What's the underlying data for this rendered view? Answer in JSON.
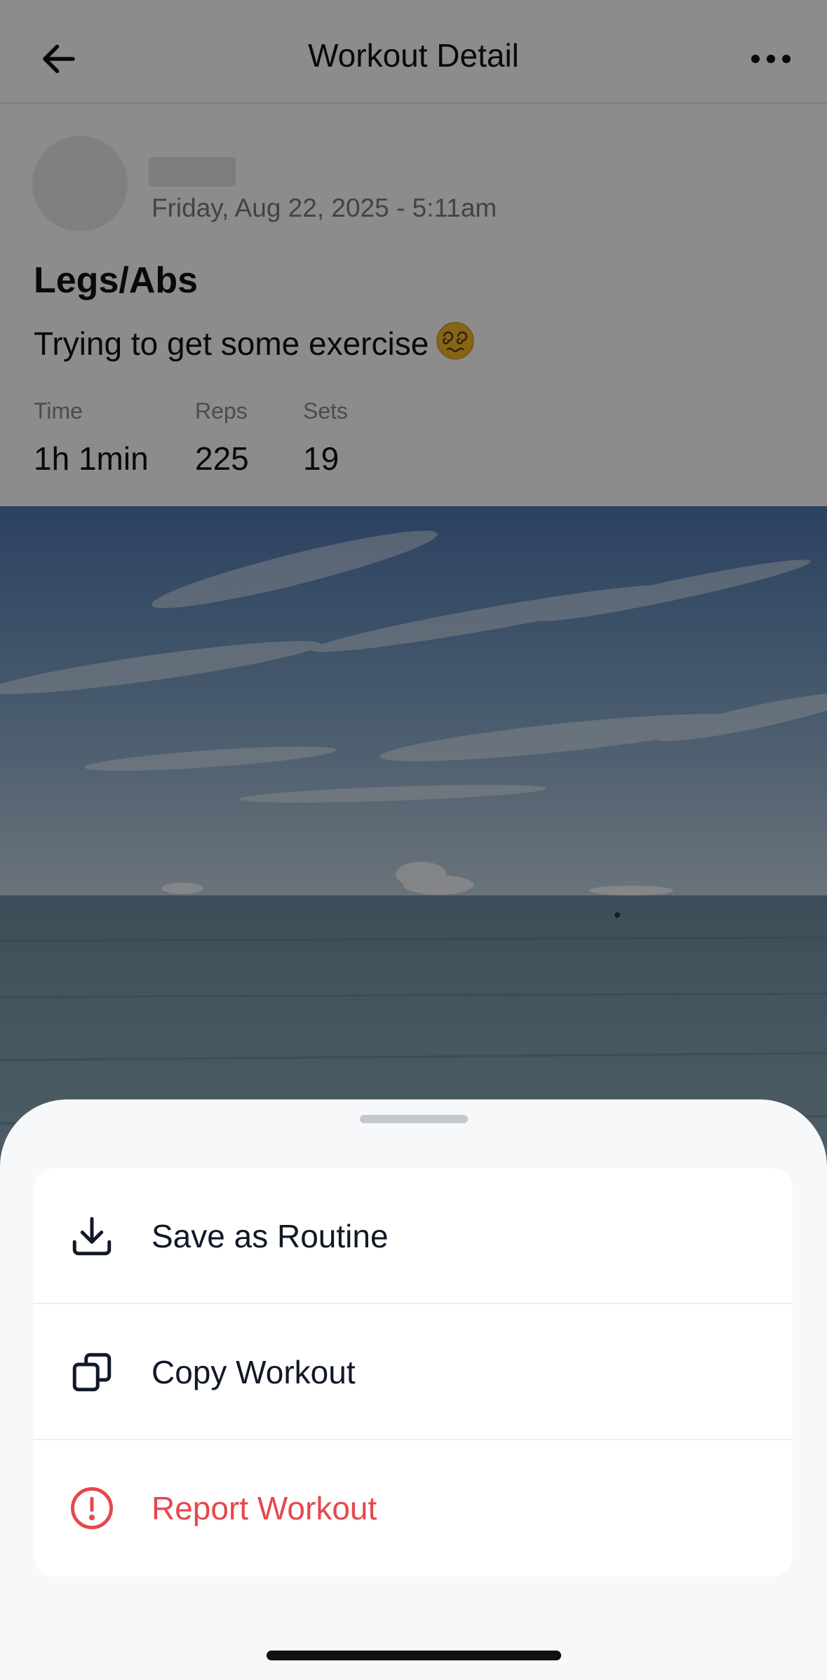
{
  "header": {
    "title": "Workout Detail",
    "back_icon": "arrow-left-icon",
    "more_icon": "more-horizontal-icon"
  },
  "post": {
    "date": "Friday, Aug 22, 2025 - 5:11am",
    "title": "Legs/Abs",
    "description": "Trying to get some exercise",
    "emoji_icon": "dizzy-face-emoji"
  },
  "stats": [
    {
      "label": "Time",
      "value": "1h 1min"
    },
    {
      "label": "Reps",
      "value": "225"
    },
    {
      "label": "Sets",
      "value": "19"
    }
  ],
  "sheet": {
    "items": [
      {
        "label": "Save as Routine",
        "icon": "download-icon"
      },
      {
        "label": "Copy Workout",
        "icon": "copy-icon"
      },
      {
        "label": "Report Workout",
        "icon": "alert-circle-icon",
        "color": "#e5484d"
      }
    ]
  },
  "colors": {
    "danger": "#e5484d",
    "sheet_bg": "#f7f8fa"
  }
}
